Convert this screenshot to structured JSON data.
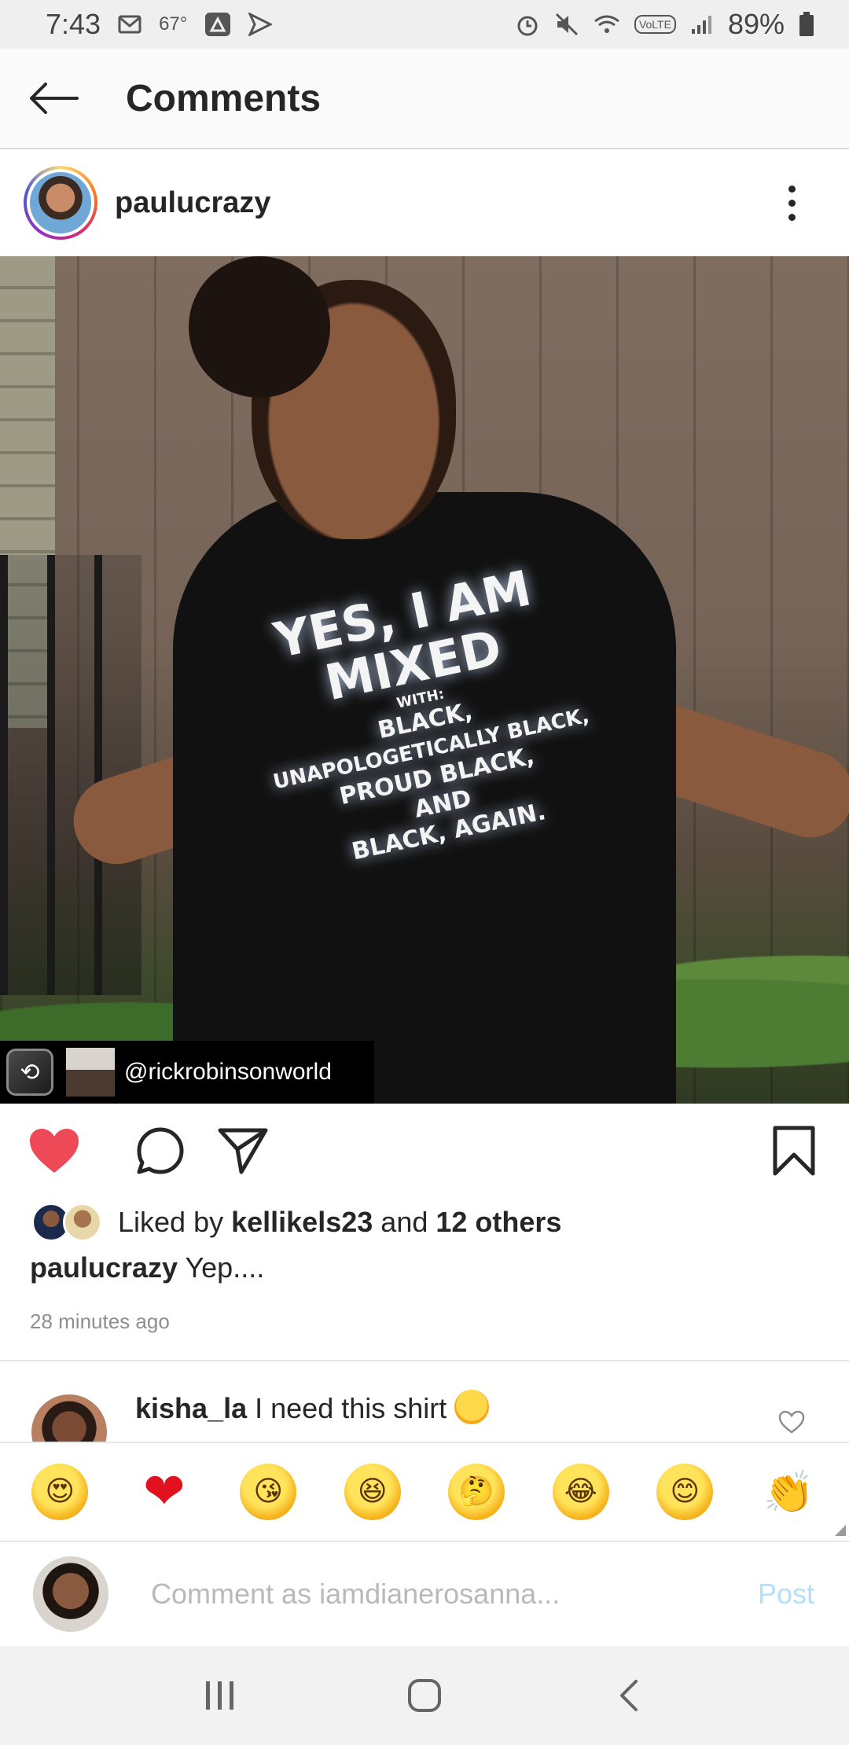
{
  "status_bar": {
    "time": "7:43",
    "temperature": "67°",
    "battery": "89%",
    "network": "VoLTE",
    "icons": [
      "gmail-icon",
      "weather-icon",
      "drive-icon",
      "send-icon",
      "alarm-icon",
      "mute-icon",
      "wifi-icon",
      "volte-icon",
      "signal-icon",
      "battery-icon"
    ]
  },
  "header": {
    "title": "Comments"
  },
  "post": {
    "username": "paulucrazy",
    "repost_credit": "@rickrobinsonworld",
    "shirt_text": {
      "line1": "YES, I AM",
      "line2": "MIXED",
      "line3": "WITH:",
      "line4": "BLACK,",
      "line5": "UNAPOLOGETICALLY BLACK,",
      "line6": "PROUD BLACK,",
      "line7": "AND",
      "line8": "BLACK, AGAIN."
    },
    "liked": true,
    "likes": {
      "prefix": "Liked by",
      "user": "kellikels23",
      "connector": "and",
      "others": "12 others"
    },
    "caption": {
      "user": "paulucrazy",
      "text": "Yep...."
    },
    "timestamp": "28 minutes ago"
  },
  "comments": [
    {
      "user": "kisha_la",
      "text": "I need this shirt"
    }
  ],
  "emoji_bar": [
    "😍",
    "❤",
    "😘",
    "😆",
    "🤔",
    "😂",
    "😊",
    "👏"
  ],
  "comment_input": {
    "placeholder": "Comment as iamdianerosanna...",
    "post_label": "Post"
  },
  "colors": {
    "accent": "#ed4956",
    "post_button_disabled": "#b2dffc",
    "text": "#262626",
    "secondary_text": "#8e8e8e"
  }
}
